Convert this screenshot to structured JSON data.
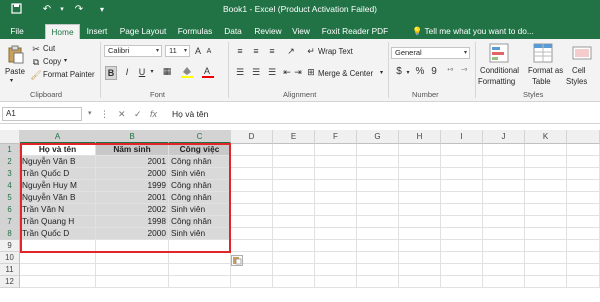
{
  "window": {
    "title": "Book1 - Excel (Product Activation Failed)",
    "quick_access": {
      "save_icon": "save-icon",
      "undo_icon": "undo-icon",
      "redo_icon": "redo-icon",
      "customize_icon": "customize-icon"
    }
  },
  "tabs": [
    "File",
    "Home",
    "Insert",
    "Page Layout",
    "Formulas",
    "Data",
    "Review",
    "View",
    "Foxit Reader PDF"
  ],
  "active_tab": "Home",
  "tell_me": "Tell me what you want to do...",
  "ribbon": {
    "clipboard": {
      "paste": "Paste",
      "cut": "Cut",
      "copy": "Copy",
      "format_painter": "Format Painter",
      "label": "Clipboard"
    },
    "font": {
      "name": "Calibri",
      "size": "11",
      "bold": "B",
      "italic": "I",
      "underline": "U",
      "label": "Font"
    },
    "alignment": {
      "wrap_text": "Wrap Text",
      "merge_center": "Merge & Center",
      "label": "Alignment"
    },
    "number": {
      "format": "General",
      "currency": "$",
      "percent": "%",
      "comma": "9",
      "label": "Number"
    },
    "styles": {
      "conditional": "Conditional",
      "formatting": "Formatting",
      "format_as": "Format as",
      "table": "Table",
      "cell": "Cell",
      "styles_btn": "Styles",
      "label": "Styles"
    }
  },
  "formula_bar": {
    "name_box": "A1",
    "fx": "fx",
    "content": "Họ và tên"
  },
  "columns": [
    "A",
    "B",
    "C",
    "D",
    "E",
    "F",
    "G",
    "H",
    "I",
    "J",
    "K"
  ],
  "rows": [
    "1",
    "2",
    "3",
    "4",
    "5",
    "6",
    "7",
    "8",
    "9",
    "10",
    "11",
    "12"
  ],
  "table": {
    "headers": [
      "Họ và tên",
      "Năm sinh",
      "Công việc"
    ],
    "data": [
      [
        "Nguyễn Văn B",
        "2001",
        "Công nhân"
      ],
      [
        "Trần Quốc D",
        "2000",
        "Sinh viên"
      ],
      [
        "Nguyễn Huy M",
        "1999",
        "Công nhân"
      ],
      [
        "Nguyễn Văn B",
        "2001",
        "Công nhân"
      ],
      [
        "Trần Văn N",
        "2002",
        "Sinh viên"
      ],
      [
        "Trần Quang H",
        "1998",
        "Công nhân"
      ],
      [
        "Trần Quốc D",
        "2000",
        "Sinh viên"
      ]
    ]
  },
  "colors": {
    "excel_green": "#217346",
    "highlight_border": "#e0262b",
    "cell_shade": "#d9d9d9"
  }
}
